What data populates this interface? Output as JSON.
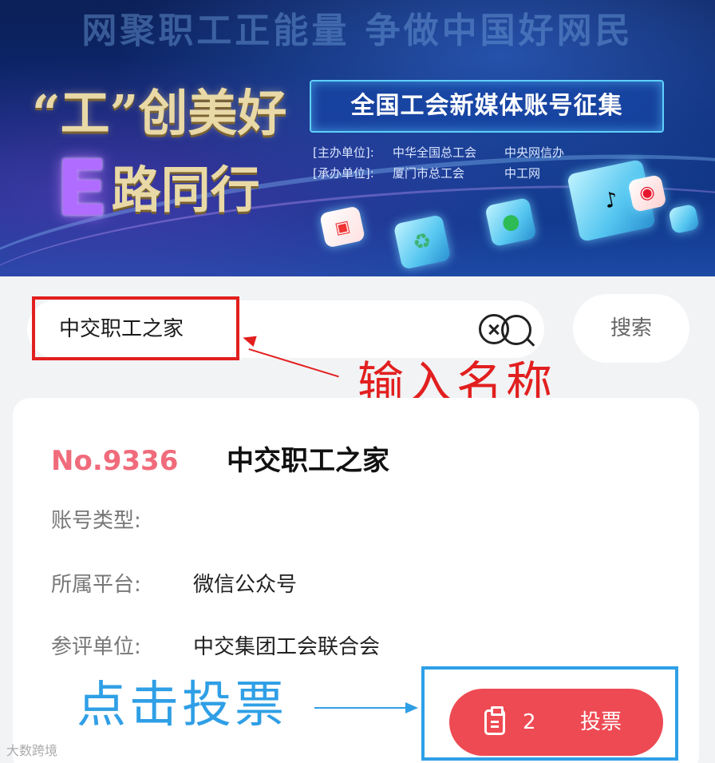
{
  "banner": {
    "slogan": "网聚职工正能量 争做中国好网民",
    "title_line1": "“工”创美好",
    "title_e": "E",
    "title_line2": "路同行",
    "collect_title": "全国工会新媒体账号征集",
    "host_label": "[主办单位]:",
    "host_1": "中华全国总工会",
    "host_2": "中央网信办",
    "organizer_label": "[承办单位]:",
    "organizer_1": "厦门市总工会",
    "organizer_2": "中工网",
    "icons": [
      "douyin-icon",
      "weibo-icon",
      "wechat-icon",
      "app-icon",
      "recycle-icon"
    ]
  },
  "search": {
    "value": "中交职工之家",
    "button_label": "搜索"
  },
  "annotations": {
    "input_hint": "输入名称",
    "vote_hint": "点击投票",
    "red_color": "#e21f1f",
    "blue_color": "#2f9fe6"
  },
  "card": {
    "number": "No.9336",
    "name": "中交职工之家",
    "type_label": "账号类型:",
    "type_value": "",
    "platform_label": "所属平台:",
    "platform_value": "微信公众号",
    "unit_label": "参评单位:",
    "unit_value": "中交集团工会联合会",
    "vote_count": "2",
    "vote_label": "投票",
    "accent": "#ee4a53",
    "number_color": "#f06b7b"
  },
  "watermark": "大数跨境"
}
